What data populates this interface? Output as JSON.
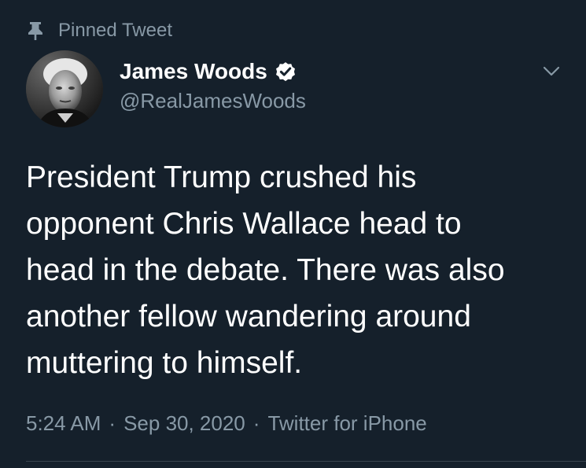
{
  "pinned": {
    "label": "Pinned Tweet",
    "icon": "pin-icon"
  },
  "author": {
    "display_name": "James Woods",
    "handle": "@RealJamesWoods",
    "verified": true,
    "avatar_icon": "avatar"
  },
  "tweet": {
    "text": "President Trump crushed his\nopponent Chris Wallace head to\nhead in the debate. There was also\nanother fellow wandering around\nmuttering to himself."
  },
  "meta": {
    "time": "5:24 AM",
    "separator1": "·",
    "date": "Sep 30, 2020",
    "separator2": "·",
    "source": "Twitter for iPhone"
  },
  "colors": {
    "background": "#15202b",
    "text": "#ffffff",
    "secondary": "#8899a6",
    "divider": "#38444d"
  }
}
